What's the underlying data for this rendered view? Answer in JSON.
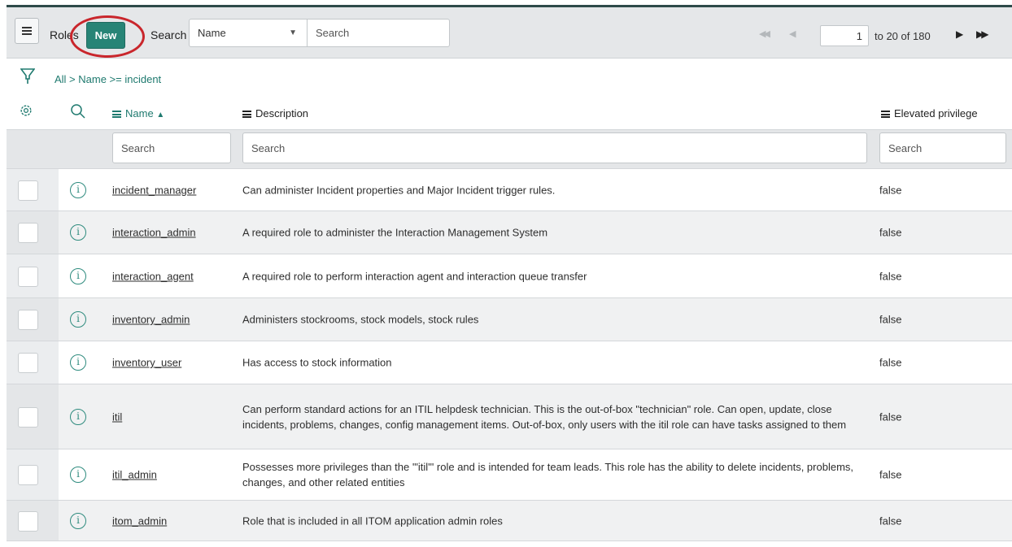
{
  "header": {
    "list_title": "Roles",
    "new_label": "New",
    "search_label": "Search",
    "search_field_selected": "Name",
    "search_placeholder": "Search"
  },
  "pagination": {
    "current_page": "1",
    "range_text": "to 20 of 180"
  },
  "filter": {
    "breadcrumb": "All > Name >= incident"
  },
  "columns": {
    "name": "Name",
    "description": "Description",
    "elevated": "Elevated privilege"
  },
  "column_search_placeholder": "Search",
  "rows": [
    {
      "name": "incident_manager",
      "description": "Can administer Incident properties and Major Incident trigger rules.",
      "elevated": "false"
    },
    {
      "name": "interaction_admin",
      "description": "A required role to administer the Interaction Management System",
      "elevated": "false"
    },
    {
      "name": "interaction_agent",
      "description": "A required role to perform interaction agent and interaction queue transfer",
      "elevated": "false"
    },
    {
      "name": "inventory_admin",
      "description": "Administers stockrooms, stock models, stock rules",
      "elevated": "false"
    },
    {
      "name": "inventory_user",
      "description": "Has access to stock information",
      "elevated": "false"
    },
    {
      "name": "itil",
      "description": "Can perform standard actions for an ITIL helpdesk technician. This is the out-of-box \"technician\" role. Can open, update, close incidents, problems, changes, config management items. Out-of-box, only users with the itil role can have tasks assigned to them",
      "elevated": "false"
    },
    {
      "name": "itil_admin",
      "description": "Possesses more privileges than the '\"itil\"' role and is intended for team leads. This role has the ability to delete incidents, problems, changes, and other related entities",
      "elevated": "false"
    },
    {
      "name": "itom_admin",
      "description": "Role that is included in all ITOM application admin roles",
      "elevated": "false"
    }
  ],
  "colors": {
    "accent": "#278476",
    "link": "#1f7a6f",
    "highlight_circle": "#c9262c"
  }
}
